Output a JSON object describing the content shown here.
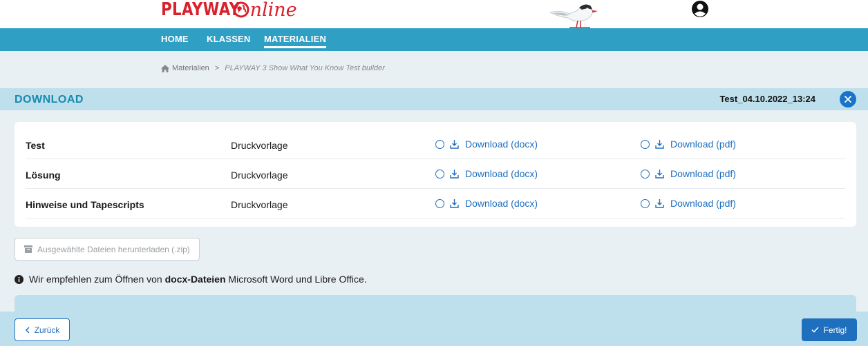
{
  "brand": {
    "name_part1": "PLAYWAY",
    "name_part2": "nline",
    "accent_color": "#d9212c"
  },
  "nav": {
    "items": [
      {
        "label": "HOME"
      },
      {
        "label": "KLASSEN"
      },
      {
        "label": "MATERIALIEN",
        "active": true
      }
    ],
    "bg_color": "#2f9fc4"
  },
  "breadcrumb": {
    "icon": "home-icon",
    "root": "Materialien",
    "separator": ">",
    "current": "PLAYWAY 3 Show What You Know Test builder"
  },
  "download_panel": {
    "title": "DOWNLOAD",
    "filename": "Test_04.10.2022_13:24",
    "close_icon": "close-icon",
    "rows": [
      {
        "name": "Test",
        "type": "Druckvorlage",
        "docx_label": "Download (docx)",
        "pdf_label": "Download (pdf)"
      },
      {
        "name": "Lösung",
        "type": "Druckvorlage",
        "docx_label": "Download (docx)",
        "pdf_label": "Download (pdf)"
      },
      {
        "name": "Hinweise und Tapescripts",
        "type": "Druckvorlage",
        "docx_label": "Download (docx)",
        "pdf_label": "Download (pdf)"
      }
    ],
    "zip_button": "Ausgewählte Dateien herunterladen (.zip)",
    "info_prefix": "Wir empfehlen zum Öffnen von ",
    "info_bold": "docx-Dateien",
    "info_suffix": " Microsoft Word und Libre Office."
  },
  "footer": {
    "back_label": "Zurück",
    "done_label": "Fertig!",
    "primary_color": "#1f6fbf"
  }
}
